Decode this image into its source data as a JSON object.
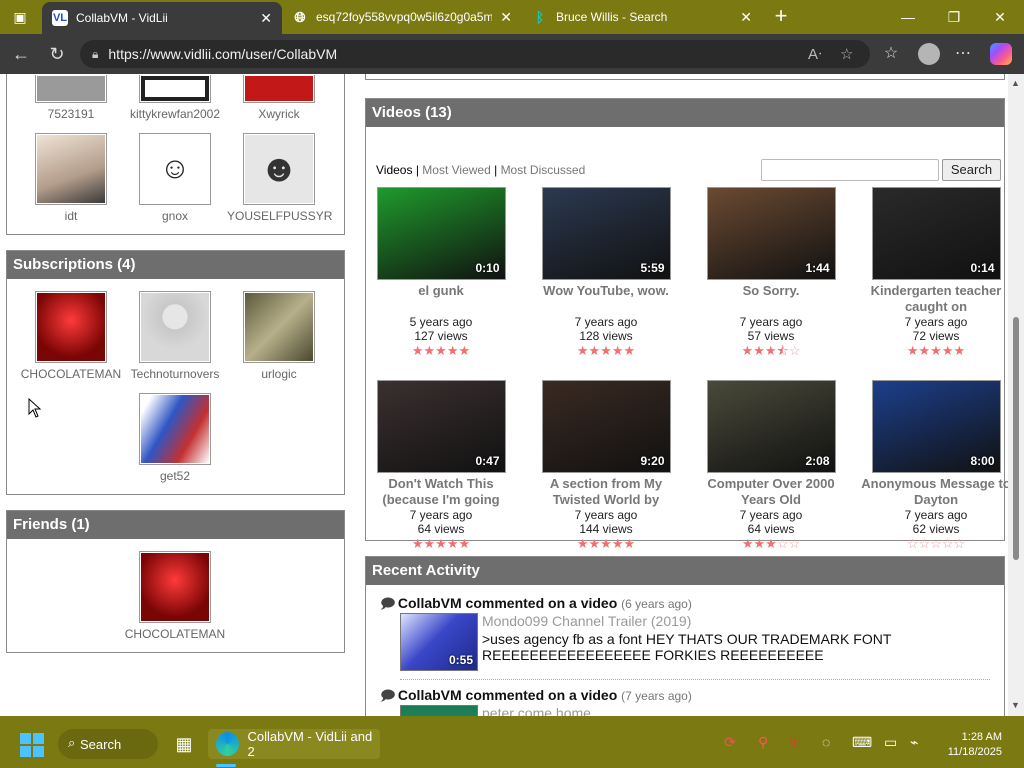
{
  "browser": {
    "tabs": [
      {
        "title": "CollabVM - VidLii",
        "favicon": "VL",
        "active": true
      },
      {
        "title": "esq72foy558vvpq0w5il6z0g0a5m",
        "favicon": "globe-icon",
        "active": false
      },
      {
        "title": "Bruce Willis - Search",
        "favicon": "bing-icon",
        "active": false
      }
    ],
    "url": "https://www.vidlii.com/user/CollabVM"
  },
  "friends_of_friends_top": [
    {
      "name": "7523191",
      "color": "#9a9a9a"
    },
    {
      "name": "kittykrewfan2002",
      "color": "#222222"
    },
    {
      "name": "Xwyrick",
      "color": "#c21818"
    },
    {
      "name": "idt",
      "color": "#c9b9a9"
    },
    {
      "name": "gnox",
      "color": "#ffffff"
    },
    {
      "name": "YOUSELFPUSSYR",
      "color": "#e0e0e0"
    }
  ],
  "subscriptions": {
    "title": "Subscriptions (4)",
    "items": [
      {
        "name": "CHOCOLATEMAN",
        "color": "#b01010"
      },
      {
        "name": "Technoturnovers",
        "color": "#cfcfcf"
      },
      {
        "name": "urlogic",
        "color": "#7d7656"
      },
      {
        "name": "get52",
        "color": "#3a5fbf"
      }
    ]
  },
  "friends": {
    "title": "Friends (1)",
    "items": [
      {
        "name": "CHOCOLATEMAN",
        "color": "#b01010"
      }
    ]
  },
  "videos": {
    "title": "Videos (13)",
    "tab_videos": "Videos",
    "sep1": " | ",
    "tab_most_viewed": "Most Viewed",
    "sep2": " | ",
    "tab_most_discussed": "Most Discussed",
    "search_button": "Search",
    "search_value": "",
    "items": [
      {
        "title": "el gunk",
        "duration": "0:10",
        "ago": "5 years ago",
        "views": "127 views",
        "rating": 5,
        "color": "#1f9a2c"
      },
      {
        "title": "Wow YouTube, wow.",
        "duration": "5:59",
        "ago": "7 years ago",
        "views": "128 views",
        "rating": 5,
        "color": "#2b3950"
      },
      {
        "title": "So Sorry.",
        "duration": "1:44",
        "ago": "7 years ago",
        "views": "57 views",
        "rating": 3.5,
        "color": "#6b4a32"
      },
      {
        "title": "Kindergarten teacher caught on",
        "duration": "0:14",
        "ago": "7 years ago",
        "views": "72 views",
        "rating": 5,
        "color": "#2a2a2a"
      },
      {
        "title": "Don't Watch This (because I'm going",
        "duration": "0:47",
        "ago": "7 years ago",
        "views": "64 views",
        "rating": 5,
        "color": "#3b3030"
      },
      {
        "title": "A section from My Twisted World by",
        "duration": "9:20",
        "ago": "7 years ago",
        "views": "144 views",
        "rating": 5,
        "color": "#3a2a22"
      },
      {
        "title": "Computer Over 2000 Years Old",
        "duration": "2:08",
        "ago": "7 years ago",
        "views": "64 views",
        "rating": 3,
        "color": "#4a4a3a"
      },
      {
        "title": "Anonymous Message to Dayton",
        "duration": "8:00",
        "ago": "7 years ago",
        "views": "62 views",
        "rating": 0,
        "color": "#1c3f8c"
      }
    ]
  },
  "recent_activity": {
    "title": "Recent Activity",
    "items": [
      {
        "user_action": "CollabVM commented on a video",
        "ago": "(6 years ago)",
        "video_title": "Mondo099 Channel Trailer (2019)",
        "duration": "0:55",
        "comment": ">uses agency fb as a font HEY THATS OUR TRADEMARK FONT REEEEEEEEEEEEEEEEE FORKIES REEEEEEEEEE",
        "color": "#3a47c8"
      },
      {
        "user_action": "CollabVM commented on a video",
        "ago": "(7 years ago)",
        "video_title": "peter come home",
        "duration": "",
        "comment": "",
        "color": "#2aa36a"
      }
    ]
  },
  "taskbar": {
    "search_label": "Search",
    "app_label": "CollabVM - VidLii and 2",
    "time": "1:28 AM",
    "date": "11/18/2025"
  }
}
